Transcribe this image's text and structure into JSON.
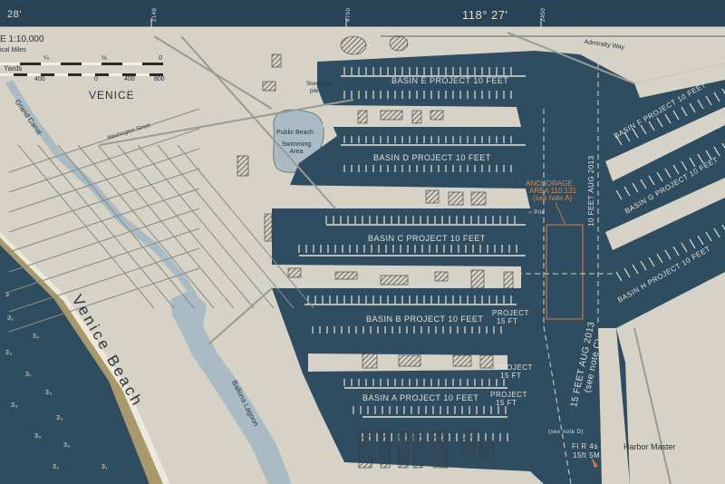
{
  "colors": {
    "water": "#2f4d60",
    "land": "#d6d2c6",
    "shallow": "#a9bcc3",
    "beach": "#a8986a",
    "road": "#9a9a94",
    "header": "#284356",
    "anchorage": "#c8763c"
  },
  "header": {
    "lon_left": "28'",
    "lon_center": "118° 27'",
    "tick_left": "2148",
    "tick_mid": "4700",
    "tick_right": "2450"
  },
  "scale": {
    "ratio": "E 1:10,000",
    "nautical_miles_label": "ical Miles",
    "nm_ticks": [
      "¼",
      "½",
      "0"
    ],
    "yards_label": "Yards",
    "yard_ticks": [
      "400",
      "0",
      "400",
      "800"
    ]
  },
  "labels": {
    "venice": "VENICE",
    "grand_canal": "Grand Canal",
    "washington_street": "Washington Street",
    "public_beach": "Public Beach",
    "swimming_area": "Swimming Area",
    "venice_beach": "Venice Beach",
    "ballona_lagoon": "Ballona Lagoon",
    "admiralty_way": "Admiralty Way",
    "storm_pipe": "Storm pipe",
    "pile_top": "pile",
    "pile": "○ Pile",
    "basin_e": "BASIN E PROJECT 10 FEET",
    "basin_d": "BASIN D PROJECT 10 FEET",
    "basin_c": "BASIN C PROJECT 10 FEET",
    "basin_b": "BASIN B PROJECT 10 FEET",
    "basin_a": "BASIN A PROJECT 10 FEET",
    "basin_f": "BASIN F PROJECT 10 FEET",
    "basin_g": "BASIN G PROJECT 10 FEET",
    "basin_h": "BASIN H PROJECT 10 FEET",
    "anchorage": "ANCHORAGE",
    "anchorage_area": "AREA 110.131",
    "anchorage_note": "(see note A)",
    "project_15_b": "PROJECT",
    "project_15_b2": "15 FT",
    "project_15_a": "PROJECT",
    "project_15_a2": "15 FT",
    "project_15_c": "PROJECT",
    "project_15_c2": "15 FT",
    "depth_channel_top": "10 FEET AUG 2013",
    "depth_channel_main": "15 FEET AUG 2013",
    "see_note_c": "(see note C)",
    "see_note_d": "(see note D)",
    "light": "Fl R 4s",
    "light2": "15ft 5M",
    "harbor_master": "Harbor Master"
  },
  "soundings": [
    "3",
    "3₁",
    "3₂",
    "3₃",
    "3₁",
    "3₃",
    "3₃",
    "3₃",
    "3₅",
    "3₃",
    "3₃",
    "3₁"
  ]
}
